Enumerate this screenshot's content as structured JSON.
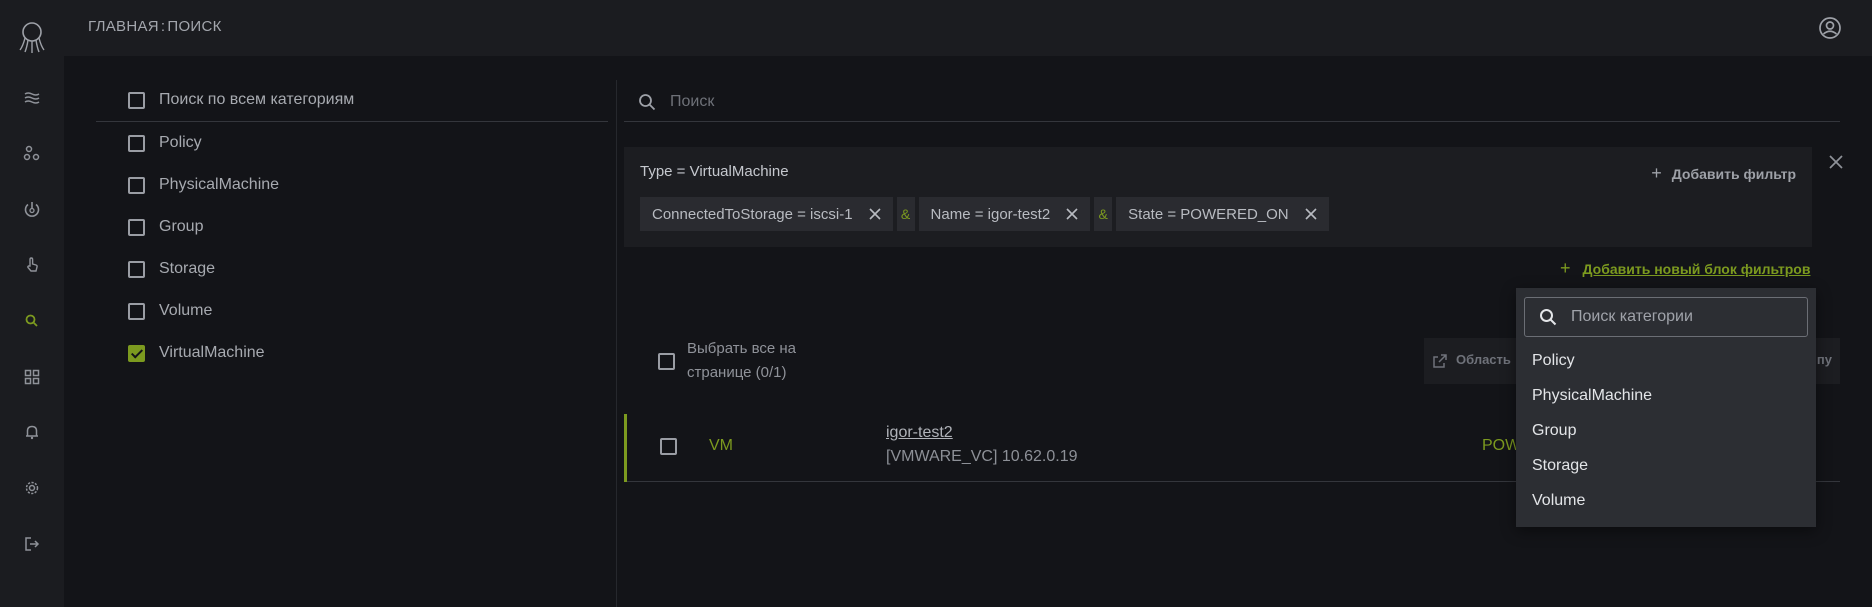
{
  "header": {
    "breadcrumb_home": "ГЛАВНАЯ",
    "breadcrumb_sep": ":",
    "breadcrumb_page": "ПОИСК"
  },
  "sidebar": {
    "icons": [
      "logo-icon",
      "layers-icon",
      "nodes-icon",
      "power-icon",
      "touch-icon",
      "search-icon",
      "dashboard-icon",
      "bell-icon",
      "gear-icon",
      "logout-icon"
    ],
    "active": "search-icon"
  },
  "categories": {
    "all_label": "Поиск по всем категориям",
    "items": [
      {
        "label": "Policy",
        "checked": false
      },
      {
        "label": "PhysicalMachine",
        "checked": false
      },
      {
        "label": "Group",
        "checked": false
      },
      {
        "label": "Storage",
        "checked": false
      },
      {
        "label": "Volume",
        "checked": false
      },
      {
        "label": "VirtualMachine",
        "checked": true
      }
    ]
  },
  "search": {
    "placeholder": "Поиск",
    "value": ""
  },
  "filter_block": {
    "type_label": "Type = VirtualMachine",
    "add_filter_label": "Добавить фильтр",
    "chips": [
      "ConnectedToStorage = iscsi-1",
      "Name = igor-test2",
      "State = POWERED_ON"
    ],
    "connector": "&",
    "add_block_label": "Добавить новый блок фильтров"
  },
  "results": {
    "select_all_line1": "Выбрать все на",
    "select_all_line2": "странице (0/1)",
    "area_button_label": "Область",
    "area_button_tail": "пу",
    "rows": [
      {
        "type": "VM",
        "name": "igor-test2",
        "sub": "[VMWARE_VC] 10.62.0.19",
        "state": "POW"
      }
    ]
  },
  "category_dropdown": {
    "placeholder": "Поиск категории",
    "options": [
      "Policy",
      "PhysicalMachine",
      "Group",
      "Storage",
      "Volume"
    ]
  },
  "colors": {
    "accent": "#7c9a1f",
    "background": "#131418",
    "panel": "#1b1c20"
  }
}
